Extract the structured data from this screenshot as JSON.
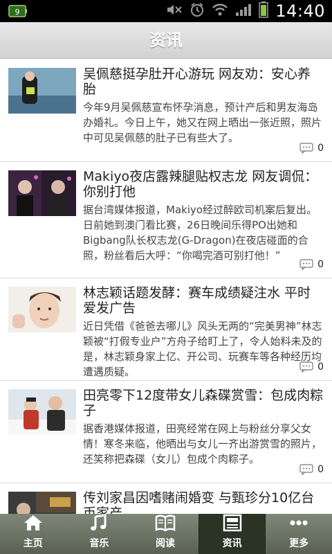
{
  "status_bar": {
    "time": "14:40",
    "left_icon": "battery-widget-icon",
    "icons": [
      "mute-icon",
      "alarm-icon",
      "wifi-icon",
      "signal-icon",
      "battery-icon"
    ]
  },
  "header": {
    "title": "资讯"
  },
  "articles": [
    {
      "title": "吴佩慈挺孕肚开心游玩 网友劝：安心养胎",
      "desc": "今年9月吴佩慈宣布怀孕消息，预计产后和男友海岛办婚礼。今日上午，她又在网上晒出一张近照，照片中可见吴佩慈的肚子已有些大了。",
      "comments": "0"
    },
    {
      "title": "Makiyo夜店露辣腿贴权志龙 网友调侃：你别打他",
      "desc": "据台湾媒体报道，Makiyo经过醉欧司机案后复出。日前她到澳门看比赛，26日晚间乐得PO出她和Bigbang队长权志龙(G-Dragon)在夜店碰面的合照，粉丝看后大呼：“你喝完酒可别打他！”",
      "comments": "0"
    },
    {
      "title": "林志颖话题发酵：赛车成绩疑注水 平时爱发广告",
      "desc": "近日凭借《爸爸去哪儿》风头无两的“完美男神”林志颖被“打假专业户”方舟子给盯上了，令人始料未及的是，林志颖身家上亿、开公司、玩赛车等各种经历均遭遇质疑。",
      "comments": "0"
    },
    {
      "title": "田亮零下12度带女儿森碟赏雪：包成肉粽子",
      "desc": "据香港媒体报道，田亮经常在网上与粉丝分享父女情！寒冬来临，他晒出与女儿一齐出游赏雪的照片，还笑称把森碟（女儿）包成个肉粽子。",
      "comments": "0"
    },
    {
      "title": "传刘家昌因嗜赌闹婚变 与甄珍分10亿台币家产",
      "desc": "",
      "comments": ""
    }
  ],
  "nav": [
    {
      "label": "主页",
      "icon": "home-icon",
      "active": false
    },
    {
      "label": "音乐",
      "icon": "music-note-icon",
      "active": false
    },
    {
      "label": "阅读",
      "icon": "book-icon",
      "active": false
    },
    {
      "label": "资讯",
      "icon": "news-icon",
      "active": true
    },
    {
      "label": "更多",
      "icon": "more-dots-icon",
      "active": false
    }
  ],
  "colors": {
    "header_bg": "#d9d9d9",
    "nav_bg": "#6b7363",
    "nav_active_bg": "#2a3324",
    "divider": "#d8d8d8"
  }
}
